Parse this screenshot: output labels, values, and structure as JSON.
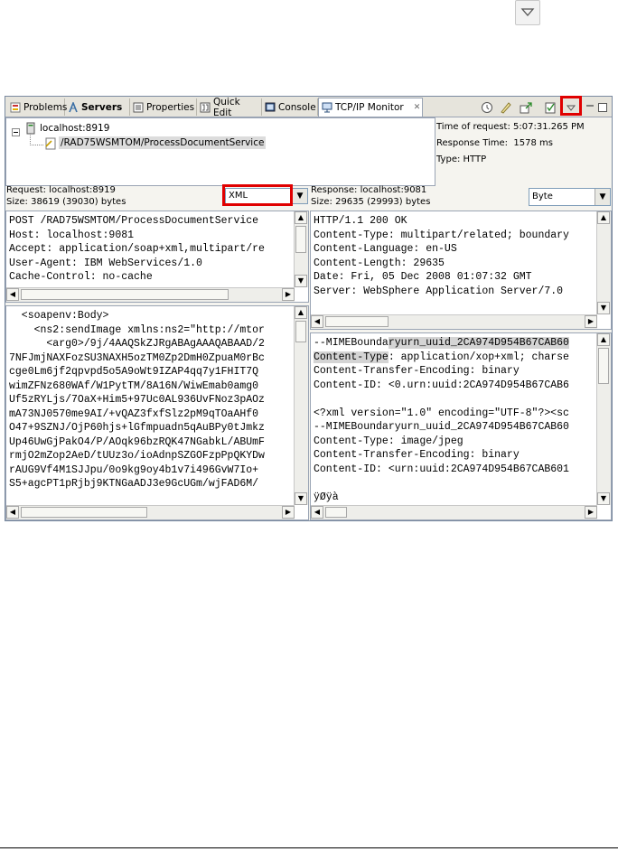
{
  "tabs": [
    {
      "label": "Problems"
    },
    {
      "label": "Servers"
    },
    {
      "label": "Properties"
    },
    {
      "label": "Quick Edit"
    },
    {
      "label": "Console"
    },
    {
      "label": "TCP/IP Monitor"
    }
  ],
  "tree": {
    "host": "localhost:8919",
    "service": "/RAD75WSMTOM/ProcessDocumentService"
  },
  "info": {
    "time_of_request": "Time of request: 5:07:31.265 PM",
    "response_time": "Response Time:  1578 ms",
    "type": "Type: HTTP"
  },
  "request": {
    "header": "Request: localhost:8919",
    "size": "Size: 38619 (39030) bytes",
    "format": "XML",
    "headers_lines": [
      "POST /RAD75WSMTOM/ProcessDocumentService",
      "Host: localhost:9081",
      "Accept: application/soap+xml,multipart/re",
      "User-Agent: IBM WebServices/1.0",
      "Cache-Control: no-cache"
    ],
    "body_lines": [
      "  <soapenv:Body>",
      "    <ns2:sendImage xmlns:ns2=\"http://mtor",
      "      <arg0>/9j/4AAQSkZJRgABAgAAAQABAAD/2",
      "7NFJmjNAXFozSU3NAXH5ozTM0Zp2DmH0ZpuaM0rBc",
      "cge0Lm6jf2qpvpd5o5A9oWt9IZAP4qq7y1FHIT7Q",
      "wimZFNz680WAf/W1PytTM/8A16N/WiwEmab0amg0",
      "Uf5zRYLjs/7OaX+Him5+97Uc0AL936UvFNoz3pAOz",
      "mA73NJ0570me9AI/+vQAZ3fxfSlz2pM9qTOaAHf0",
      "O47+9SZNJ/OjP60hjs+lGfmpuadn5qAuBPy0tJmkz",
      "Up46UwGjPakO4/P/AOqk96bzRQK47NGabkL/ABUmF",
      "rmjO2mZop2AeD/tUUz3o/ioAdnpSZGOFzpPpQKYDw",
      "rAUG9Vf4M1SJJpu/0o9kg9oy4b1v7i496GvW7Io+",
      "S5+agcPT1pRjbj9KTNGaADJ3e9GcUGm/wjFAD6M/"
    ]
  },
  "response": {
    "header": "Response: localhost:9081",
    "size": "Size: 29635 (29993) bytes",
    "format": "Byte",
    "headers_lines": [
      "HTTP/1.1 200 OK",
      "Content-Type: multipart/related; boundary",
      "Content-Language: en-US",
      "Content-Length: 29635",
      "Date: Fri, 05 Dec 2008 01:07:32 GMT",
      "Server: WebSphere Application Server/7.0"
    ],
    "body_lines": [
      "--MIMEBoundaryurn_uuid_2CA974D954B67CAB60",
      "Content-Type: application/xop+xml; charse",
      "Content-Transfer-Encoding: binary",
      "Content-ID: <0.urn:uuid:2CA974D954B67CAB6",
      "",
      "<?xml version=\"1.0\" encoding=\"UTF-8\"?><sc",
      "--MIMEBoundaryurn_uuid_2CA974D954B67CAB60",
      "Content-Type: image/jpeg",
      "Content-Transfer-Encoding: binary",
      "Content-ID: <urn:uuid:2CA974D954B67CAB601",
      "",
      "ÿØÿà"
    ]
  },
  "colors": {
    "highlight_box": "#e00000",
    "tab_bar": "#e6e4dc",
    "selection": "#d4d4d4"
  }
}
